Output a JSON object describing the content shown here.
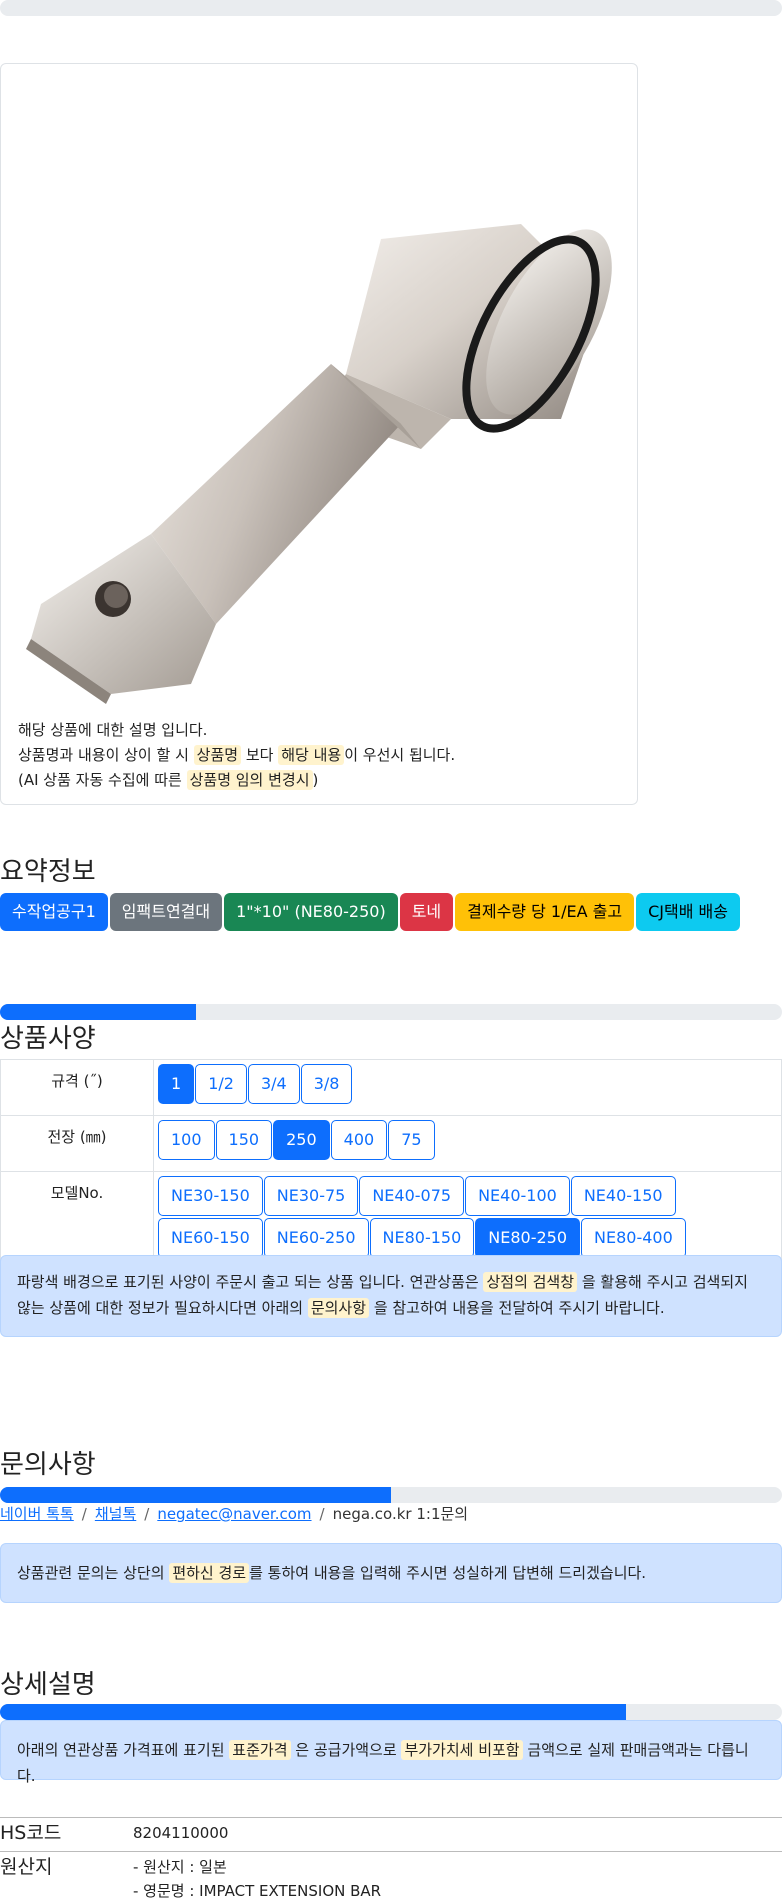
{
  "product_image": {
    "alt": "impact extension bar image"
  },
  "card": {
    "line1": "해당 상품에 대한 설명 입니다.",
    "line2_a": "상품명과 내용이 상이 할 시",
    "line2_hl1": "상품명",
    "line2_b": "보다",
    "line2_hl2": "해당 내용",
    "line2_c": "이 우선시 됩니다.",
    "line3_a": "(AI 상품 자동 수집에 따른",
    "line3_hl": "상품명 임의 변경시",
    "line3_b": ")"
  },
  "summary": {
    "title": "요약정보",
    "badges": [
      "수작업공구1",
      "임팩트연결대",
      "1\"*10\" (NE80-250)",
      "토네",
      "결제수량 당 1/EA 출고",
      "CJ택배 배송"
    ]
  },
  "specs": {
    "title": "상품사양",
    "progress_pct": 25,
    "rows": [
      {
        "label": "규격 (˝)",
        "options": [
          "1",
          "1/2",
          "3/4",
          "3/8"
        ],
        "selected": "1"
      },
      {
        "label": "전장 (㎜)",
        "options": [
          "100",
          "150",
          "250",
          "400",
          "75"
        ],
        "selected": "250"
      },
      {
        "label": "모델No.",
        "options": [
          "NE30-150",
          "NE30-75",
          "NE40-075",
          "NE40-100",
          "NE40-150",
          "NE60-150",
          "NE60-250",
          "NE80-150",
          "NE80-250",
          "NE80-400"
        ],
        "selected": "NE80-250"
      }
    ],
    "notice_a": "파랑색 배경으로 표기된 사양이 주문시 출고 되는 상품 입니다. 연관상품은",
    "notice_hl1": "상점의 검색창",
    "notice_b": "을 활용해 주시고 검색되지 않는 상품에 대한 정보가 필요하시다면 아래의",
    "notice_hl2": "문의사항",
    "notice_c": "을 참고하여 내용을 전달하여 주시기 바랍니다."
  },
  "inquiry": {
    "title": "문의사항",
    "progress_pct": 50,
    "links": [
      "네이버 톡톡",
      "채널톡",
      "negatec@naver.com"
    ],
    "plain": "nega.co.kr 1:1문의",
    "notice_a": "상품관련 문의는 상단의",
    "notice_hl": "편하신 경로",
    "notice_b": "를 통하여 내용을 입력해 주시면 성실하게 답변해 드리겠습니다."
  },
  "detail": {
    "title": "상세설명",
    "progress_pct": 80,
    "notice_a": "아래의 연관상품 가격표에 표기된",
    "notice_hl1": "표준가격",
    "notice_b": "은 공급가액으로",
    "notice_hl2": "부가가치세 비포함",
    "notice_c": "금액으로 실제 판매금액과는 다릅니다.",
    "hs_label": "HS코드",
    "hs_value": "8204110000",
    "origin_label": "원산지",
    "origin_line1": "- 원산지 : 일본",
    "origin_line2": "- 영문명 : IMPACT EXTENSION BAR"
  },
  "colors": {
    "primary": "#0d6efd",
    "highlight": "#fff3cd",
    "alert_bg": "#cfe2ff"
  }
}
